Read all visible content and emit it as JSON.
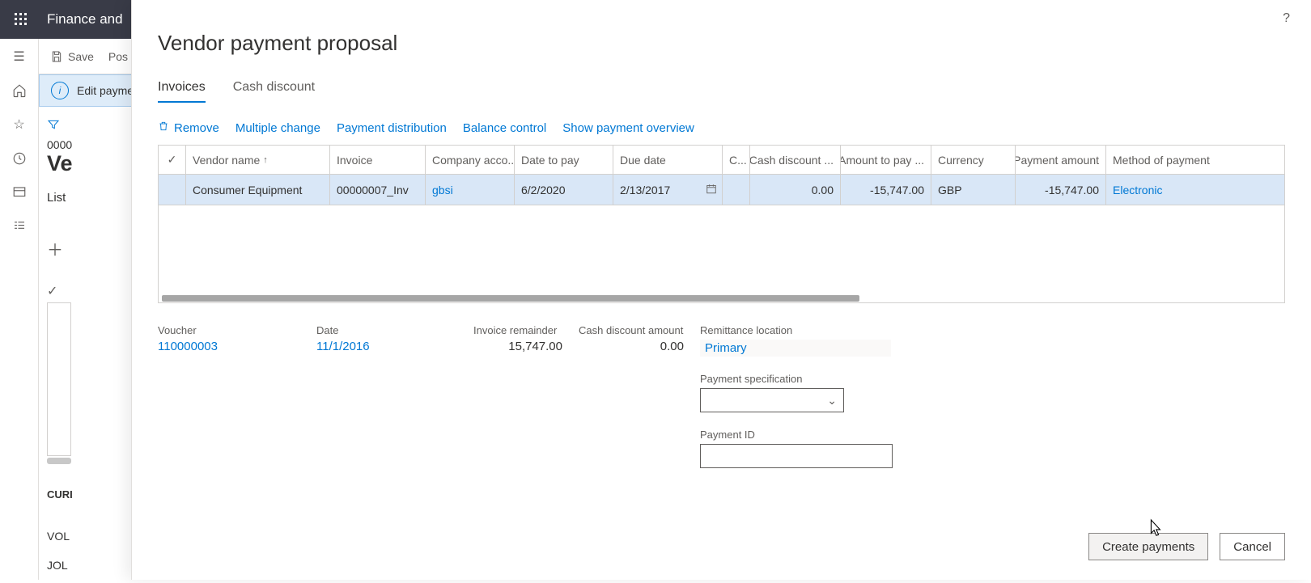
{
  "app": {
    "title": "Finance and"
  },
  "actionbar": {
    "save": "Save",
    "post_prefix": "Pos"
  },
  "editbar": {
    "label": "Edit paymer"
  },
  "bg": {
    "id_prefix": "0000",
    "heading_prefix": "Ve",
    "tab": "List",
    "currency_label": "CURI",
    "voucher_label": "VOL",
    "journal_label": "JOL"
  },
  "panel": {
    "title": "Vendor payment proposal",
    "tabs": {
      "invoices": "Invoices",
      "cash_discount": "Cash discount"
    },
    "actions": {
      "remove": "Remove",
      "multiple_change": "Multiple change",
      "payment_distribution": "Payment distribution",
      "balance_control": "Balance control",
      "show_overview": "Show payment overview"
    },
    "grid": {
      "headers": {
        "vendor": "Vendor name",
        "invoice": "Invoice",
        "company": "Company acco...",
        "date_to_pay": "Date to pay",
        "due_date": "Due date",
        "cc": "C...",
        "cash_discount": "Cash discount ...",
        "amount_to_pay": "Amount to pay ...",
        "currency": "Currency",
        "payment_amount": "Payment amount",
        "method": "Method of payment"
      },
      "row": {
        "vendor": "Consumer Equipment",
        "invoice": "00000007_Inv",
        "company": "gbsi",
        "date_to_pay": "6/2/2020",
        "due_date": "2/13/2017",
        "cc": "",
        "cash_discount": "0.00",
        "amount_to_pay": "-15,747.00",
        "currency": "GBP",
        "payment_amount": "-15,747.00",
        "method": "Electronic"
      }
    },
    "details": {
      "voucher_label": "Voucher",
      "voucher": "110000003",
      "date_label": "Date",
      "date": "11/1/2016",
      "invoice_remainder_label": "Invoice remainder",
      "invoice_remainder": "15,747.00",
      "cash_discount_amount_label": "Cash discount amount",
      "cash_discount_amount": "0.00",
      "remittance_label": "Remittance location",
      "remittance": "Primary",
      "payment_spec_label": "Payment specification",
      "payment_id_label": "Payment ID"
    },
    "buttons": {
      "create": "Create payments",
      "cancel": "Cancel"
    }
  }
}
